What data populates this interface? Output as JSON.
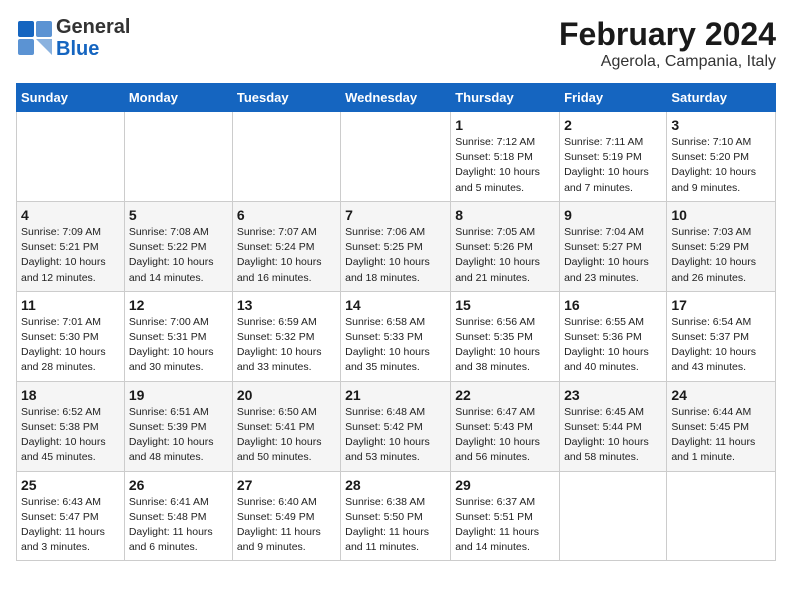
{
  "logo": {
    "text_general": "General",
    "text_blue": "Blue"
  },
  "header": {
    "title": "February 2024",
    "subtitle": "Agerola, Campania, Italy"
  },
  "weekdays": [
    "Sunday",
    "Monday",
    "Tuesday",
    "Wednesday",
    "Thursday",
    "Friday",
    "Saturday"
  ],
  "weeks": [
    [
      {
        "day": "",
        "detail": ""
      },
      {
        "day": "",
        "detail": ""
      },
      {
        "day": "",
        "detail": ""
      },
      {
        "day": "",
        "detail": ""
      },
      {
        "day": "1",
        "detail": "Sunrise: 7:12 AM\nSunset: 5:18 PM\nDaylight: 10 hours\nand 5 minutes."
      },
      {
        "day": "2",
        "detail": "Sunrise: 7:11 AM\nSunset: 5:19 PM\nDaylight: 10 hours\nand 7 minutes."
      },
      {
        "day": "3",
        "detail": "Sunrise: 7:10 AM\nSunset: 5:20 PM\nDaylight: 10 hours\nand 9 minutes."
      }
    ],
    [
      {
        "day": "4",
        "detail": "Sunrise: 7:09 AM\nSunset: 5:21 PM\nDaylight: 10 hours\nand 12 minutes."
      },
      {
        "day": "5",
        "detail": "Sunrise: 7:08 AM\nSunset: 5:22 PM\nDaylight: 10 hours\nand 14 minutes."
      },
      {
        "day": "6",
        "detail": "Sunrise: 7:07 AM\nSunset: 5:24 PM\nDaylight: 10 hours\nand 16 minutes."
      },
      {
        "day": "7",
        "detail": "Sunrise: 7:06 AM\nSunset: 5:25 PM\nDaylight: 10 hours\nand 18 minutes."
      },
      {
        "day": "8",
        "detail": "Sunrise: 7:05 AM\nSunset: 5:26 PM\nDaylight: 10 hours\nand 21 minutes."
      },
      {
        "day": "9",
        "detail": "Sunrise: 7:04 AM\nSunset: 5:27 PM\nDaylight: 10 hours\nand 23 minutes."
      },
      {
        "day": "10",
        "detail": "Sunrise: 7:03 AM\nSunset: 5:29 PM\nDaylight: 10 hours\nand 26 minutes."
      }
    ],
    [
      {
        "day": "11",
        "detail": "Sunrise: 7:01 AM\nSunset: 5:30 PM\nDaylight: 10 hours\nand 28 minutes."
      },
      {
        "day": "12",
        "detail": "Sunrise: 7:00 AM\nSunset: 5:31 PM\nDaylight: 10 hours\nand 30 minutes."
      },
      {
        "day": "13",
        "detail": "Sunrise: 6:59 AM\nSunset: 5:32 PM\nDaylight: 10 hours\nand 33 minutes."
      },
      {
        "day": "14",
        "detail": "Sunrise: 6:58 AM\nSunset: 5:33 PM\nDaylight: 10 hours\nand 35 minutes."
      },
      {
        "day": "15",
        "detail": "Sunrise: 6:56 AM\nSunset: 5:35 PM\nDaylight: 10 hours\nand 38 minutes."
      },
      {
        "day": "16",
        "detail": "Sunrise: 6:55 AM\nSunset: 5:36 PM\nDaylight: 10 hours\nand 40 minutes."
      },
      {
        "day": "17",
        "detail": "Sunrise: 6:54 AM\nSunset: 5:37 PM\nDaylight: 10 hours\nand 43 minutes."
      }
    ],
    [
      {
        "day": "18",
        "detail": "Sunrise: 6:52 AM\nSunset: 5:38 PM\nDaylight: 10 hours\nand 45 minutes."
      },
      {
        "day": "19",
        "detail": "Sunrise: 6:51 AM\nSunset: 5:39 PM\nDaylight: 10 hours\nand 48 minutes."
      },
      {
        "day": "20",
        "detail": "Sunrise: 6:50 AM\nSunset: 5:41 PM\nDaylight: 10 hours\nand 50 minutes."
      },
      {
        "day": "21",
        "detail": "Sunrise: 6:48 AM\nSunset: 5:42 PM\nDaylight: 10 hours\nand 53 minutes."
      },
      {
        "day": "22",
        "detail": "Sunrise: 6:47 AM\nSunset: 5:43 PM\nDaylight: 10 hours\nand 56 minutes."
      },
      {
        "day": "23",
        "detail": "Sunrise: 6:45 AM\nSunset: 5:44 PM\nDaylight: 10 hours\nand 58 minutes."
      },
      {
        "day": "24",
        "detail": "Sunrise: 6:44 AM\nSunset: 5:45 PM\nDaylight: 11 hours\nand 1 minute."
      }
    ],
    [
      {
        "day": "25",
        "detail": "Sunrise: 6:43 AM\nSunset: 5:47 PM\nDaylight: 11 hours\nand 3 minutes."
      },
      {
        "day": "26",
        "detail": "Sunrise: 6:41 AM\nSunset: 5:48 PM\nDaylight: 11 hours\nand 6 minutes."
      },
      {
        "day": "27",
        "detail": "Sunrise: 6:40 AM\nSunset: 5:49 PM\nDaylight: 11 hours\nand 9 minutes."
      },
      {
        "day": "28",
        "detail": "Sunrise: 6:38 AM\nSunset: 5:50 PM\nDaylight: 11 hours\nand 11 minutes."
      },
      {
        "day": "29",
        "detail": "Sunrise: 6:37 AM\nSunset: 5:51 PM\nDaylight: 11 hours\nand 14 minutes."
      },
      {
        "day": "",
        "detail": ""
      },
      {
        "day": "",
        "detail": ""
      }
    ]
  ]
}
